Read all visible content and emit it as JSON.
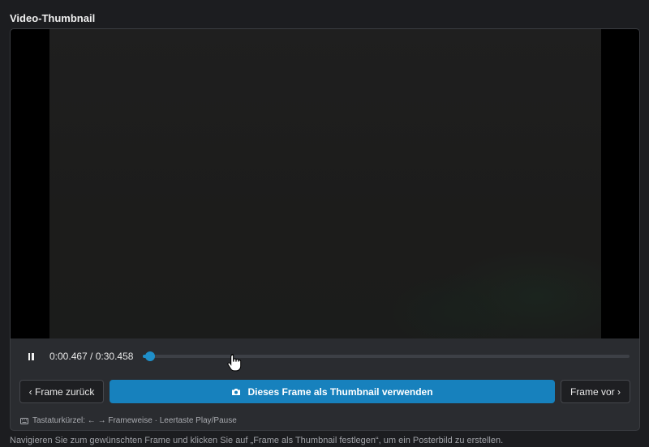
{
  "section_title": "Video-Thumbnail",
  "player": {
    "play_state": "playing",
    "time_display": "0:00.467 / 0:30.458",
    "progress_fraction": 0.0153
  },
  "buttons": {
    "prev_frame": "‹ Frame zurück",
    "set_thumbnail": "Dieses Frame als Thumbnail verwenden",
    "next_frame": "Frame vor ›"
  },
  "shortcut_hint": "Tastaturkürzel: ← → Frameweise · Leertaste Play/Pause",
  "footer_text": "Navigieren Sie zum gewünschten Frame und klicken Sie auf „Frame als Thumbnail festlegen“, um ein Posterbild zu erstellen.",
  "icons": {
    "play_button": "pause-icon",
    "set_thumbnail": "camera-icon",
    "shortcut_hint": "keyboard-icon"
  },
  "colors": {
    "accent": "#1f8fc9",
    "primary_button": "#1781bd",
    "background": "#1c1d20",
    "panel": "#2a2c30"
  }
}
